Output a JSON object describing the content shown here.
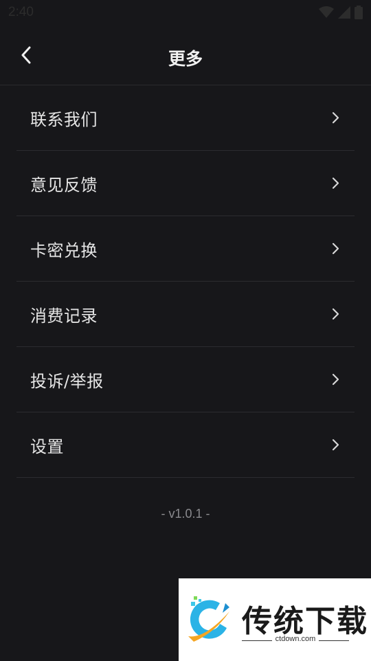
{
  "status_bar": {
    "time": "2:40",
    "icons": [
      "wifi-icon",
      "signal-icon",
      "battery-icon"
    ]
  },
  "header": {
    "title": "更多",
    "back_icon": "chevron-left-icon"
  },
  "menu": {
    "items": [
      {
        "label": "联系我们"
      },
      {
        "label": "意见反馈"
      },
      {
        "label": "卡密兑换"
      },
      {
        "label": "消费记录"
      },
      {
        "label": "投诉/举报"
      },
      {
        "label": "设置"
      }
    ]
  },
  "version": "- v1.0.1 -",
  "watermark": {
    "name": "传统下载",
    "domain": "ctdown.com"
  },
  "colors": {
    "background": "#17171a",
    "text": "#e6e6e6",
    "divider": "#2c2c30",
    "muted": "#8a8a8e"
  }
}
